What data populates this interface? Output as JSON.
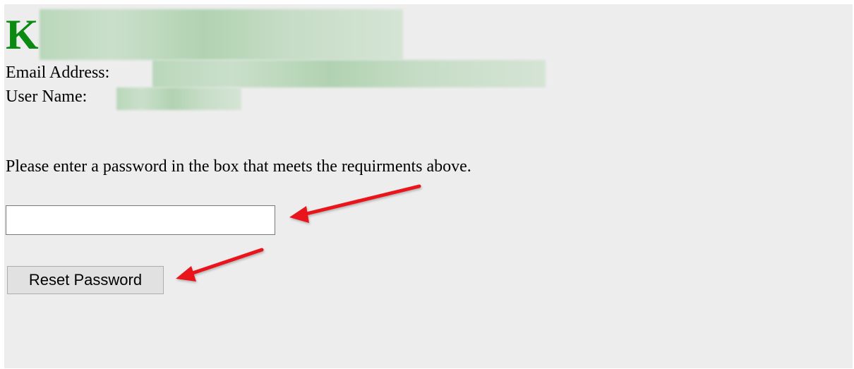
{
  "brand": {
    "initial": "K",
    "color": "#0b8a12"
  },
  "account": {
    "email_label": "Email Address:",
    "user_label": "User Name:"
  },
  "form": {
    "instructions": "Please enter a password in the box that meets the requirments above.",
    "password_value": "",
    "reset_button_label": "Reset Password"
  },
  "annotations": {
    "arrow_color": "#e8161b"
  }
}
